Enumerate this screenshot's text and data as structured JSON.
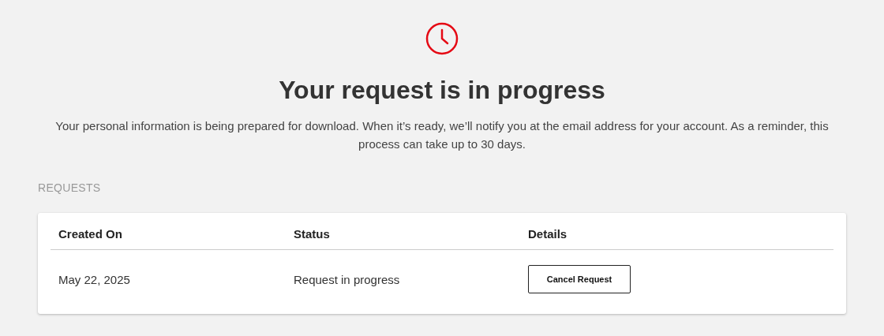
{
  "header": {
    "title": "Your request is in progress",
    "message": "Your personal information is being prepared for download. When it’s ready, we’ll notify you at the email address for your account. As a reminder, this process can take up to 30 days."
  },
  "requests": {
    "heading": "REQUESTS",
    "columns": [
      "Created On",
      "Status",
      "Details"
    ],
    "rows": [
      {
        "created_on": "May 22, 2025",
        "status": "Request in progress",
        "action": "Cancel Request"
      }
    ]
  }
}
